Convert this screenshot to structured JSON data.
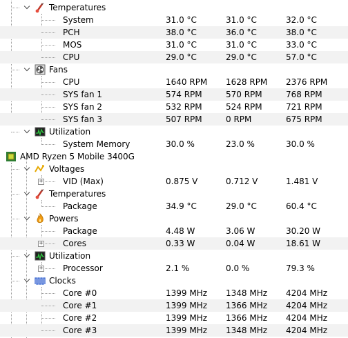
{
  "rows": [
    {
      "type": "group",
      "label": "Temperatures",
      "icon": "thermometer-icon"
    },
    {
      "type": "leaf",
      "label": "System",
      "values": [
        "31.0 °C",
        "31.0 °C",
        "32.0 °C"
      ]
    },
    {
      "type": "leaf",
      "label": "PCH",
      "values": [
        "38.0 °C",
        "36.0 °C",
        "38.0 °C"
      ]
    },
    {
      "type": "leaf",
      "label": "MOS",
      "values": [
        "31.0 °C",
        "31.0 °C",
        "33.0 °C"
      ]
    },
    {
      "type": "leaf",
      "label": "CPU",
      "values": [
        "29.0 °C",
        "29.0 °C",
        "57.0 °C"
      ]
    },
    {
      "type": "group",
      "label": "Fans",
      "icon": "fan-icon"
    },
    {
      "type": "leaf",
      "label": "CPU",
      "values": [
        "1640 RPM",
        "1628 RPM",
        "2376 RPM"
      ]
    },
    {
      "type": "leaf",
      "label": "SYS fan 1",
      "values": [
        "574 RPM",
        "570 RPM",
        "768 RPM"
      ]
    },
    {
      "type": "leaf",
      "label": "SYS fan 2",
      "values": [
        "532 RPM",
        "524 RPM",
        "721 RPM"
      ]
    },
    {
      "type": "leaf",
      "label": "SYS fan 3",
      "values": [
        "507 RPM",
        "0 RPM",
        "675 RPM"
      ]
    },
    {
      "type": "group",
      "label": "Utilization",
      "icon": "utilization-monitor-icon"
    },
    {
      "type": "leaf",
      "label": "System Memory",
      "values": [
        "30.0 %",
        "23.0 %",
        "30.0 %"
      ]
    },
    {
      "type": "device",
      "label": "AMD Ryzen 5 Mobile 3400G",
      "icon": "processor-chip-icon"
    },
    {
      "type": "group",
      "label": "Voltages",
      "icon": "voltage-icon"
    },
    {
      "type": "leaf",
      "label": "VID (Max)",
      "values": [
        "0.875 V",
        "0.712 V",
        "1.481 V"
      ],
      "expandable": true
    },
    {
      "type": "group",
      "label": "Temperatures",
      "icon": "thermometer-icon"
    },
    {
      "type": "leaf",
      "label": "Package",
      "values": [
        "34.9 °C",
        "29.0 °C",
        "60.4 °C"
      ]
    },
    {
      "type": "group",
      "label": "Powers",
      "icon": "power-flame-icon"
    },
    {
      "type": "leaf",
      "label": "Package",
      "values": [
        "4.48 W",
        "3.06 W",
        "30.20 W"
      ]
    },
    {
      "type": "leaf",
      "label": "Cores",
      "values": [
        "0.33 W",
        "0.04 W",
        "18.61 W"
      ],
      "expandable": true
    },
    {
      "type": "group",
      "label": "Utilization",
      "icon": "utilization-monitor-icon"
    },
    {
      "type": "leaf",
      "label": "Processor",
      "values": [
        "2.1 %",
        "0.0 %",
        "79.3 %"
      ],
      "expandable": true
    },
    {
      "type": "group",
      "label": "Clocks",
      "icon": "clock-waveform-icon"
    },
    {
      "type": "leaf",
      "label": "Core #0",
      "values": [
        "1399 MHz",
        "1348 MHz",
        "4204 MHz"
      ]
    },
    {
      "type": "leaf",
      "label": "Core #1",
      "values": [
        "1399 MHz",
        "1366 MHz",
        "4204 MHz"
      ]
    },
    {
      "type": "leaf",
      "label": "Core #2",
      "values": [
        "1399 MHz",
        "1366 MHz",
        "4204 MHz"
      ]
    },
    {
      "type": "leaf",
      "label": "Core #3",
      "values": [
        "1399 MHz",
        "1348 MHz",
        "4204 MHz"
      ]
    }
  ],
  "colors": {
    "alt_row": "#f2f2f2",
    "tree_line": "#9a9a9a",
    "text": "#000000"
  }
}
